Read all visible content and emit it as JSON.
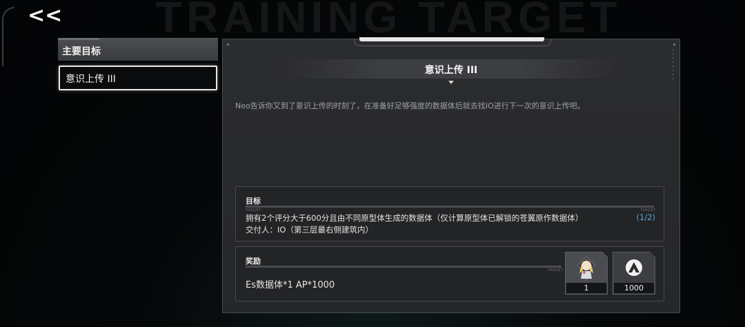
{
  "background_title": "TRAINING TARGET",
  "nav": {
    "back_label": "<<"
  },
  "sidebar": {
    "header": "主要目标",
    "items": [
      {
        "label": "意识上传 III",
        "selected": true
      }
    ]
  },
  "panel": {
    "title": "意识上传 III",
    "description": "Neo告诉你又到了意识上传的时刻了，在准备好足够强度的数据体后就去找IO进行下一次的意识上传吧。",
    "goal": {
      "label": "目标",
      "tag": "TARGET",
      "text": "拥有2个评分大于600分且由不同原型体生成的数据体（仅计算原型体已解锁的苍翼原作数据体）",
      "progress": "(1/2)",
      "submitter": "交付人：IO（第三层最右侧建筑内）"
    },
    "reward": {
      "label": "奖励",
      "tag": "TARGET",
      "text": "Es数据体*1  AP*1000",
      "items": [
        {
          "icon": "character-portrait-icon",
          "qty": "1"
        },
        {
          "icon": "ap-token-icon",
          "qty": "1000"
        }
      ]
    }
  },
  "colors": {
    "accent": "#5aa6d6",
    "panel": "#2a2b2d",
    "selected_border": "#e9e9e9"
  }
}
